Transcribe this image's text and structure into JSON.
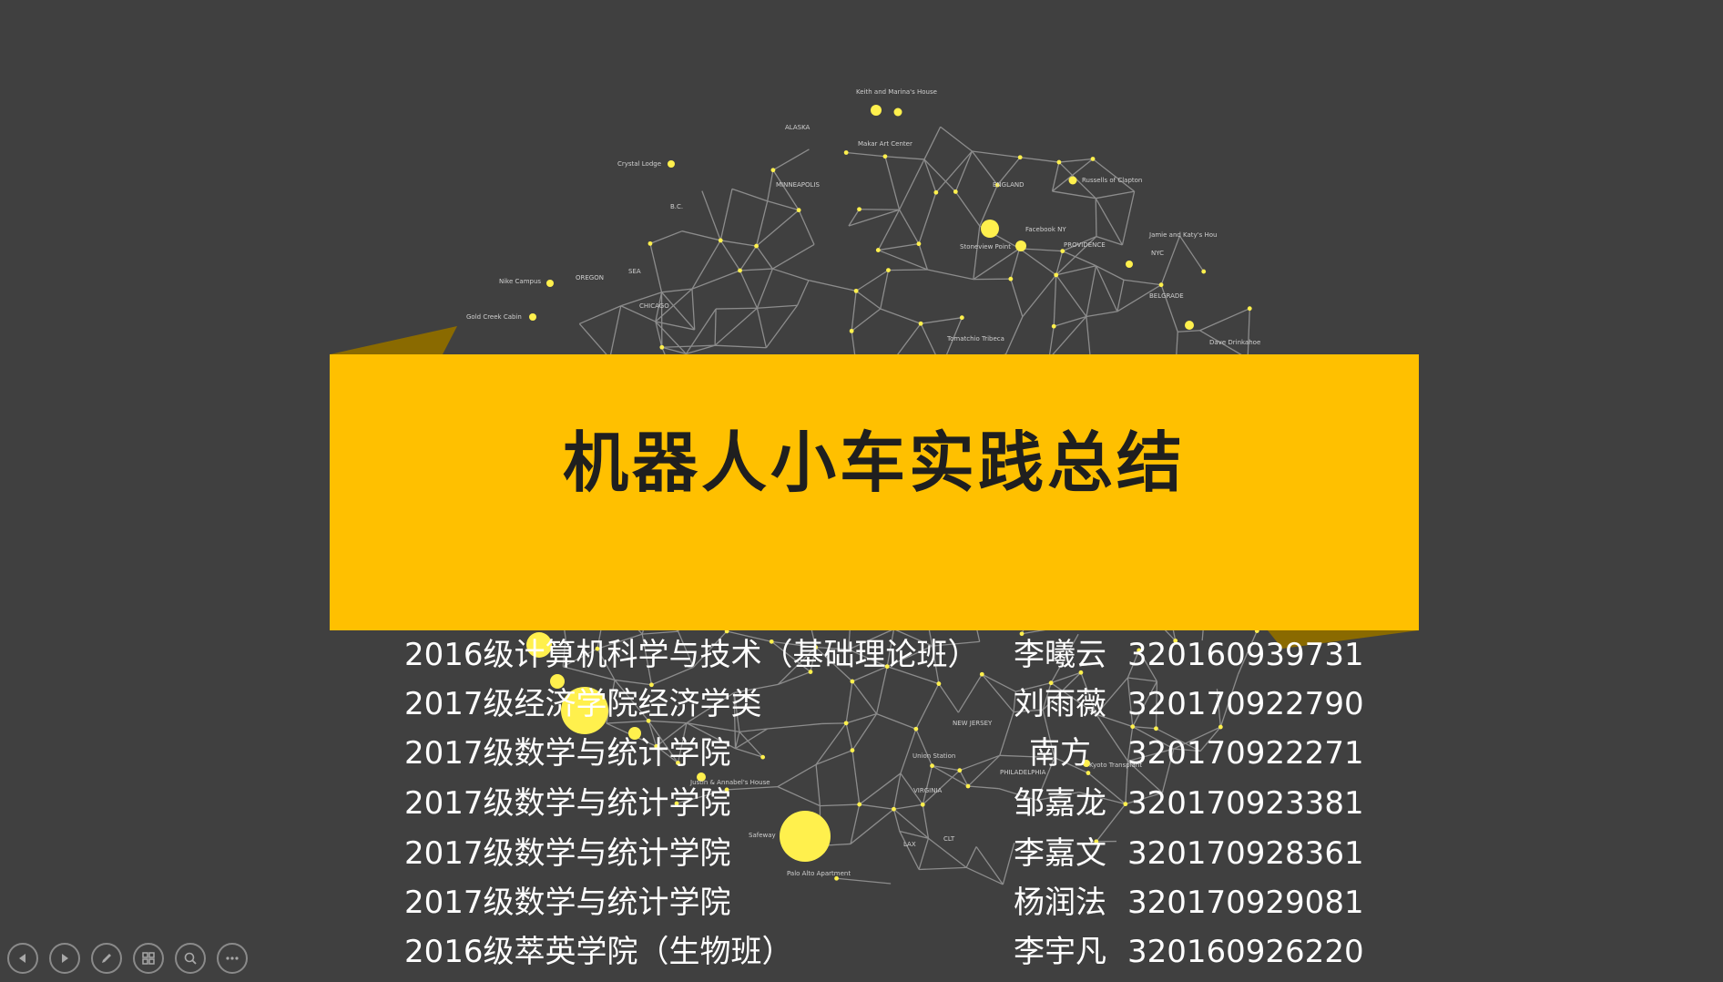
{
  "slide": {
    "title": "机器人小车实践总结",
    "members": [
      {
        "dept": "2016级计算机科学与技术（基础理论班）",
        "name": "李曦云",
        "id": "320160939731"
      },
      {
        "dept": "2017级经济学院经济学类",
        "name": "刘雨薇",
        "id": "320170922790"
      },
      {
        "dept": "2017级数学与统计学院",
        "name": "南方",
        "id": "320170922271"
      },
      {
        "dept": "2017级数学与统计学院",
        "name": "邹嘉龙",
        "id": "320170923381"
      },
      {
        "dept": "2017级数学与统计学院",
        "name": "李嘉文",
        "id": "320170928361"
      },
      {
        "dept": "2017级数学与统计学院",
        "name": "杨润法",
        "id": "320170929081"
      },
      {
        "dept": "2016级萃英学院（生物班）",
        "name": "李宇凡",
        "id": "320160926220"
      }
    ]
  },
  "background_map_labels": [
    "Keith and Marina's House",
    "ALASKA",
    "Makar Art Center",
    "Crystal Lodge",
    "MINNEAPOLIS",
    "ENGLAND",
    "Russells of Clapton",
    "B.C.",
    "Facebook NY",
    "PROVIDENCE",
    "Stoneview Point",
    "Jamie and Katy's Hou",
    "NYC",
    "Nike Campus",
    "OREGON",
    "SEA",
    "CHICAGO",
    "BELGRADE",
    "Gold Creek Cabin",
    "Dave Drinkahoe",
    "NEW JERSEY",
    "Union Station",
    "PHILADELPHIA",
    "Kyoto Transplant",
    "VIRGINIA",
    "Justin & Annabel's House",
    "Safeway",
    "LAX",
    "Palo Alto Apartment",
    "CLT",
    "Tomatchio Tribeca"
  ],
  "controls": [
    {
      "icon": "previous-icon"
    },
    {
      "icon": "next-icon"
    },
    {
      "icon": "pen-icon"
    },
    {
      "icon": "slides-icon"
    },
    {
      "icon": "zoom-icon"
    },
    {
      "icon": "more-icon"
    }
  ],
  "colors": {
    "background": "#404040",
    "banner": "#FFC000",
    "banner_shadow": "#8A6A00",
    "network_line": "#9a9a9a",
    "node": "#FFF04D",
    "text": "#FFFFFF"
  }
}
